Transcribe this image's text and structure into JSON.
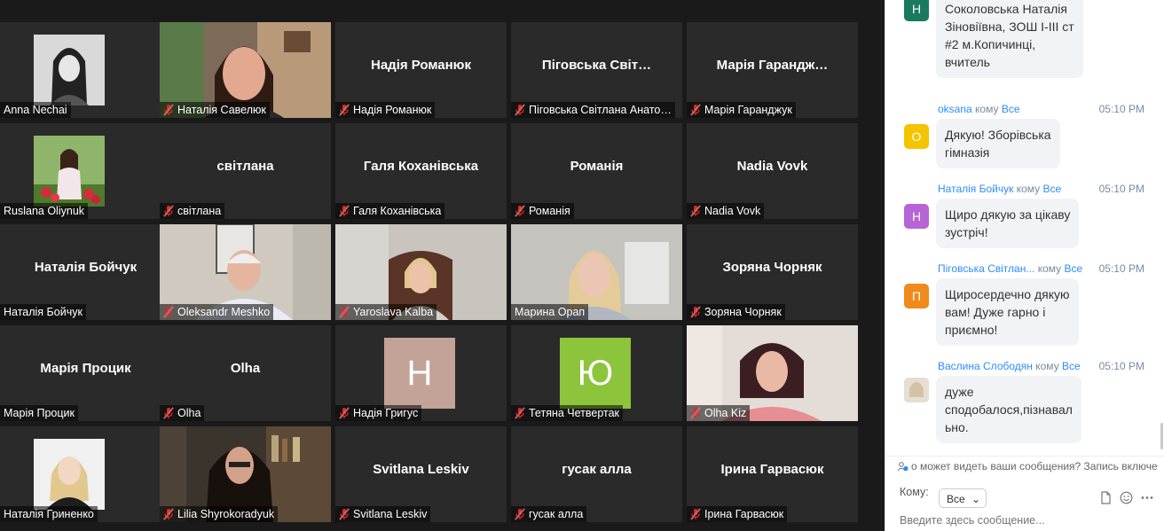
{
  "gallery": {
    "tiles": [
      {
        "name": "Anna Nechai",
        "center": "",
        "muted": false,
        "kind": "photo-bw"
      },
      {
        "name": "Наталія Савелюк",
        "center": "",
        "muted": true,
        "kind": "video-woman"
      },
      {
        "name": "Надія Романюк",
        "center": "Надія Романюк",
        "muted": true,
        "kind": "name"
      },
      {
        "name": "Піговська Світлана Анато…",
        "center": "Піговська  Світ…",
        "muted": true,
        "kind": "name"
      },
      {
        "name": "Марія Гаранджук",
        "center": "Марія  Гарандж…",
        "muted": true,
        "kind": "name"
      },
      {
        "name": "Ruslana Oliynuk",
        "center": "",
        "muted": false,
        "kind": "photo-flowers"
      },
      {
        "name": "світлана",
        "center": "світлана",
        "muted": true,
        "kind": "name"
      },
      {
        "name": "Галя Коханівська",
        "center": "Галя Коханівська",
        "muted": true,
        "kind": "name"
      },
      {
        "name": "Романія",
        "center": "Романія",
        "muted": true,
        "kind": "name"
      },
      {
        "name": "Nadia Vovk",
        "center": "Nadia Vovk",
        "muted": true,
        "kind": "name"
      },
      {
        "name": "Наталія Бойчук",
        "center": "Наталія Бойчук",
        "muted": false,
        "kind": "name"
      },
      {
        "name": "Oleksandr Meshko",
        "center": "",
        "muted": true,
        "kind": "video-man"
      },
      {
        "name": "Yaroslava Kalba",
        "center": "",
        "muted": true,
        "kind": "video-office"
      },
      {
        "name": "Марина Орап",
        "center": "",
        "muted": false,
        "kind": "video-blonde",
        "active": true
      },
      {
        "name": "Зоряна Чорняк",
        "center": "Зоряна Чорняк",
        "muted": true,
        "kind": "name"
      },
      {
        "name": "Марія Процик",
        "center": "Марія Процик",
        "muted": false,
        "kind": "name"
      },
      {
        "name": "Olha",
        "center": "Olha",
        "muted": true,
        "kind": "name"
      },
      {
        "name": "Надія Григус",
        "center": "",
        "muted": true,
        "kind": "letter",
        "letter": "Н",
        "color": "#c3a397"
      },
      {
        "name": "Тетяна Четвертак",
        "center": "",
        "muted": true,
        "kind": "letter",
        "letter": "Ю",
        "color": "#8cc43c"
      },
      {
        "name": "Olha Kiz",
        "center": "",
        "muted": true,
        "kind": "video-teacher"
      },
      {
        "name": "Наталія Гриненко",
        "center": "",
        "muted": false,
        "kind": "photo-blonde"
      },
      {
        "name": "Lilia Shyrokoradyuk",
        "center": "",
        "muted": true,
        "kind": "video-library"
      },
      {
        "name": "Svitlana Leskiv",
        "center": "Svitlana Leskiv",
        "muted": true,
        "kind": "name"
      },
      {
        "name": "гусак алла",
        "center": "гусак алла",
        "muted": true,
        "kind": "name"
      },
      {
        "name": "Ірина Гарвасюк",
        "center": "Ірина Гарвасюк",
        "muted": true,
        "kind": "name"
      }
    ]
  },
  "chat": {
    "messages": [
      {
        "sender": "",
        "to_prefix": "",
        "to": "",
        "time": "",
        "avatar_letter": "Н",
        "avatar_color": "#1a7a5e",
        "text_lines": [
          "Соколовська Наталія",
          "Зіновіївна, ЗОШ I-III ст",
          "#2 м.Копичинці,",
          "вчитель"
        ]
      },
      {
        "sender": "oksana",
        "to_prefix": "кому",
        "to": "Все",
        "time": "05:10 PM",
        "avatar_letter": "O",
        "avatar_color": "#f5c400",
        "text_lines": [
          "Дякую! Зборівська",
          "гімназія"
        ]
      },
      {
        "sender": "Наталія Бойчук",
        "to_prefix": "кому",
        "to": "Все",
        "time": "05:10 PM",
        "avatar_letter": "Н",
        "avatar_color": "#b664d6",
        "text_lines": [
          "Щиро дякую за цікаву",
          "зустріч!"
        ]
      },
      {
        "sender": "Піговська Світлан...",
        "to_prefix": "кому",
        "to": "Все",
        "time": "05:10 PM",
        "avatar_letter": "П",
        "avatar_color": "#ef8a1d",
        "text_lines": [
          "Щиросердечно дякую",
          "вам! Дуже гарно і",
          "приємно!"
        ]
      },
      {
        "sender": "Васлина Слободян",
        "to_prefix": "кому",
        "to": "Все",
        "time": "05:10 PM",
        "avatar_letter": "",
        "avatar_color": "#d8cfc4",
        "text_lines": [
          "дуже",
          "сподобалося,пізнавал",
          "ьно."
        ]
      }
    ],
    "notice": "о может видеть ваши сообщения? Запись включе",
    "to_label": "Кому:",
    "to_value": "Все",
    "input_placeholder": "Введите здесь сообщение..."
  }
}
